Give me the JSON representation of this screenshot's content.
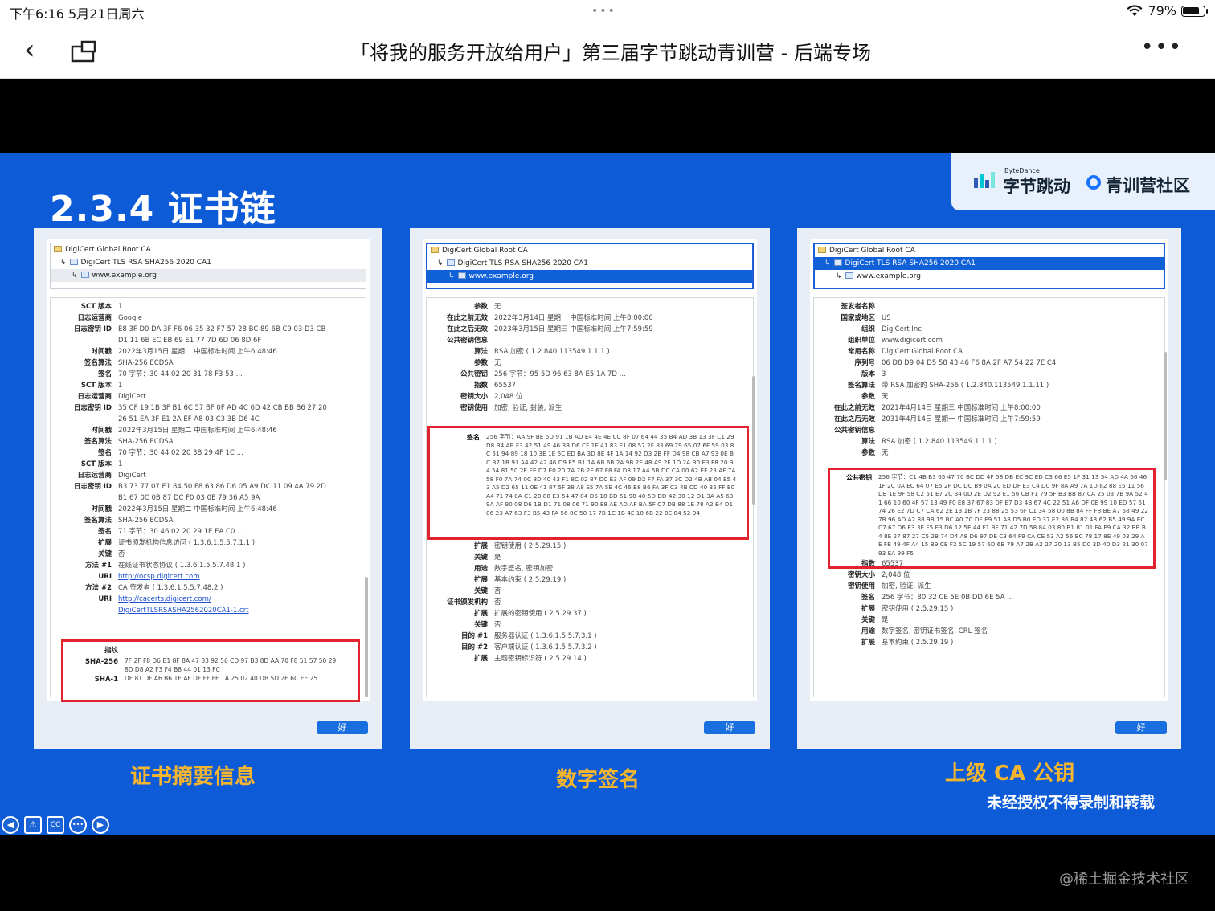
{
  "status_bar": {
    "time_date": "下午6:16   5月21日周六",
    "dots": "•••",
    "battery": "79%",
    "battery_level": 0.79
  },
  "nav": {
    "back_icon": "chevron-left-icon",
    "window_icon": "picture-in-picture-icon",
    "title": "「将我的服务开放给用户」第三届字节跳动青训营 - 后端专场",
    "more": "•••"
  },
  "slide": {
    "title": "2.3.4 证书链",
    "logo_small": "ByteDance",
    "logo_bytedance": "字节跳动",
    "logo_community": "青训营社区",
    "captions": [
      "证书摘要信息",
      "数字签名",
      "上级 CA 公钥"
    ],
    "notice": "未经授权不得录制和转载"
  },
  "panels": [
    {
      "tree": [
        "DigiCert Global Root CA",
        "DigiCert TLS RSA SHA256 2020 CA1",
        "www.example.org"
      ],
      "selected": 2,
      "ok": "好",
      "details": [
        {
          "k": "SCT 版本",
          "v": "1"
        },
        {
          "k": "日志运营商",
          "v": "Google"
        },
        {
          "k": "日志密钥 ID",
          "v": "E8 3F D0 DA 3F F6 06 35 32 F7 57 28 BC 89 6B C9 03 D3 CB"
        },
        {
          "k": "",
          "v": "D1 11 6B EC EB 69 E1 77 7D 6D 06 8D 6F"
        },
        {
          "k": "时间戳",
          "v": "2022年3月15日 星期二 中国标准时间 上午6:48:46"
        },
        {
          "k": "签名算法",
          "v": "SHA-256 ECDSA"
        },
        {
          "k": "签名",
          "v": "70 字节：30 44 02 20 31 78 F3 53 ..."
        },
        {
          "k": "SCT 版本",
          "v": "1"
        },
        {
          "k": "日志运营商",
          "v": "DigiCert"
        },
        {
          "k": "日志密钥 ID",
          "v": "35 CF 19 1B 3F B1 6C 57 BF 0F AD 4C 6D 42 CB BB B6 27 20"
        },
        {
          "k": "",
          "v": "26 51 EA 3F E1 2A EF A8 03 C3 3B D6 4C"
        },
        {
          "k": "时间戳",
          "v": "2022年3月15日 星期二 中国标准时间 上午6:48:46"
        },
        {
          "k": "签名算法",
          "v": "SHA-256 ECDSA"
        },
        {
          "k": "签名",
          "v": "70 字节：30 44 02 20 3B 29 4F 1C ..."
        },
        {
          "k": "SCT 版本",
          "v": "1"
        },
        {
          "k": "日志运营商",
          "v": "DigiCert"
        },
        {
          "k": "日志密钥 ID",
          "v": "B3 73 77 07 E1 84 50 F8 63 86 D6 05 A9 DC 11 09 4A 79 2D"
        },
        {
          "k": "",
          "v": "B1 67 0C 0B 87 DC F0 03 0E 79 36 A5 9A"
        },
        {
          "k": "时间戳",
          "v": "2022年3月15日 星期二 中国标准时间 上午6:48:46"
        },
        {
          "k": "签名算法",
          "v": "SHA-256 ECDSA"
        },
        {
          "k": "签名",
          "v": "71 字节：30 46 02 20 29 1E EA C0 ..."
        },
        {
          "k": "",
          "v": ""
        },
        {
          "k": "扩展",
          "v": "证书颁发机构信息访问 ( 1.3.6.1.5.5.7.1.1 )"
        },
        {
          "k": "关键",
          "v": "否"
        },
        {
          "k": "方法 #1",
          "v": "在线证书状态协议 ( 1.3.6.1.5.5.7.48.1 )"
        },
        {
          "k": "URI",
          "v": "http://ocsp.digicert.com",
          "link": true
        },
        {
          "k": "方法 #2",
          "v": "CA 签发者 ( 1.3.6.1.5.5.7.48.2 )"
        },
        {
          "k": "URI",
          "v": "http://cacerts.digicert.com/",
          "link": true
        },
        {
          "k": "",
          "v": "DigiCertTLSRSASHA2562020CA1-1.crt",
          "link": true
        }
      ],
      "fingerprint": {
        "label": "指纹",
        "sha256_label": "SHA-256",
        "sha256": "7F 2F F8 D6 B1 8F 8A 47 83 92 56 CD 97 B3 8D AA 70 F8 51 57 50 29 8D D8 A2 F3 F4 B8 44 01 13 FC",
        "sha1_label": "SHA-1",
        "sha1": "DF 81 DF A6 B6 1E AF DF FF FE 1A 25 02 40 DB 5D 2E 6C EE 25"
      }
    },
    {
      "tree": [
        "DigiCert Global Root CA",
        "DigiCert TLS RSA SHA256 2020 CA1",
        "www.example.org"
      ],
      "selected": 2,
      "ok": "好",
      "details": [
        {
          "k": "参数",
          "v": "无"
        },
        {
          "k": "",
          "v": ""
        },
        {
          "k": "在此之前无效",
          "v": "2022年3月14日 星期一 中国标准时间 上午8:00:00"
        },
        {
          "k": "在此之后无效",
          "v": "2023年3月15日 星期三 中国标准时间 上午7:59:59"
        },
        {
          "k": "",
          "v": ""
        },
        {
          "k": "公共密钥信息",
          "v": ""
        },
        {
          "k": "算法",
          "v": "RSA 加密 ( 1.2.840.113549.1.1.1 )"
        },
        {
          "k": "参数",
          "v": "无"
        },
        {
          "k": "公共密钥",
          "v": "256 字节：95 5D 96 63 8A E5 1A 7D ..."
        },
        {
          "k": "指数",
          "v": "65537"
        },
        {
          "k": "密钥大小",
          "v": "2,048 位"
        },
        {
          "k": "密钥使用",
          "v": "加密, 验证, 封装, 派生"
        }
      ],
      "signature": {
        "label": "签名",
        "value": "256 字节：AA 9F BE 5D 91 1B AD E4 4E 4E CC 8F 07 64 44 35 B4 AD 3B 13 3F C1 29 D8 B4 AB F3 42 51 49 46 3B D6 CF 1E 41 83 E1 08 57 2F 83 69 79 65 07 6F 59 03 8C 51 94 89 18 10 3E 1E 5C ED BA 3D 8E 4F 1A 14 92 D3 2B FF D4 98 CB A7 93 0E BC B7 1B 93 A4 42 42 46 D9 E5 B1 1A 6B 6B 2A 9B 2E 48 A9 2F 1D 2A B0 E3 F8 20 94 54 81 50 2E EE D7 E0 20 7A 7B 2E 67 F8 FA D8 17 A4 5B DC CA 00 62 EF 23 AF 7A 58 F0 7A 74 0C 8D 40 43 F1 8C 02 87 DC E3 AF 09 D2 F7 FA 37 3C D2 4B AB 04 E5 43 A5 D2 65 11 0E 41 87 5F 38 A8 E5 7A 5E 4C 46 B8 B6 FA 3F C3 4B CD 40 35 FF E0 A4 71 74 0A C1 20 88 E3 54 47 84 D5 18 BD 51 98 40 5D DD 42 30 12 D1 3A A5 63 9A AF 90 08 D6 1B D1 71 08 06 71 90 E8 AE AD AF BA 5F C7 DB 88 1E 78 A2 B4 D1 06 23 A7 63 F3 B5 43 FA 56 8C 50 17 7B 1C 1B 4E 10 6B 22 0E 84 52 94"
      },
      "details2": [
        {
          "k": "扩展",
          "v": "密钥使用 ( 2.5.29.15 )"
        },
        {
          "k": "关键",
          "v": "是"
        },
        {
          "k": "用途",
          "v": "数字签名, 密钥加密"
        },
        {
          "k": "",
          "v": ""
        },
        {
          "k": "扩展",
          "v": "基本约束 ( 2.5.29.19 )"
        },
        {
          "k": "关键",
          "v": "否"
        },
        {
          "k": "证书颁发机构",
          "v": "否"
        },
        {
          "k": "",
          "v": ""
        },
        {
          "k": "扩展",
          "v": "扩展的密钥使用 ( 2.5.29.37 )"
        },
        {
          "k": "关键",
          "v": "否"
        },
        {
          "k": "目的 #1",
          "v": "服务器认证 ( 1.3.6.1.5.5.7.3.1 )"
        },
        {
          "k": "目的 #2",
          "v": "客户端认证 ( 1.3.6.1.5.5.7.3.2 )"
        },
        {
          "k": "",
          "v": ""
        },
        {
          "k": "扩展",
          "v": "主题密钥标识符 ( 2.5.29.14 )"
        }
      ]
    },
    {
      "tree": [
        "DigiCert Global Root CA",
        "DigiCert TLS RSA SHA256 2020 CA1",
        "www.example.org"
      ],
      "selected": 1,
      "ok": "好",
      "details": [
        {
          "k": "签发者名称",
          "v": ""
        },
        {
          "k": "国家或地区",
          "v": "US"
        },
        {
          "k": "组织",
          "v": "DigiCert Inc"
        },
        {
          "k": "组织单位",
          "v": "www.digicert.com"
        },
        {
          "k": "常用名称",
          "v": "DigiCert Global Root CA"
        },
        {
          "k": "",
          "v": ""
        },
        {
          "k": "序列号",
          "v": "06 D8 D9 04 D5 58 43 46 F6 8A 2F A7 54 22 7E C4"
        },
        {
          "k": "版本",
          "v": "3"
        },
        {
          "k": "签名算法",
          "v": "带 RSA 加密的 SHA-256 ( 1.2.840.113549.1.1.11 )"
        },
        {
          "k": "参数",
          "v": "无"
        },
        {
          "k": "",
          "v": ""
        },
        {
          "k": "在此之前无效",
          "v": "2021年4月14日 星期三 中国标准时间 上午8:00:00"
        },
        {
          "k": "在此之后无效",
          "v": "2031年4月14日 星期一 中国标准时间 上午7:59:59"
        },
        {
          "k": "",
          "v": ""
        },
        {
          "k": "公共密钥信息",
          "v": ""
        },
        {
          "k": "算法",
          "v": "RSA 加密 ( 1.2.840.113549.1.1.1 )"
        },
        {
          "k": "参数",
          "v": "无"
        }
      ],
      "public_key": {
        "label": "公共密钥",
        "value": "256 字节：C1 4B B3 65 47 70 BC DD 4F 58 DB EC 9C ED C3 66 E5 1F 31 13 54 AD 4A 66 46 1F 2C 0A EC 64 07 E5 2F DC DC B9 0A 20 ED DF E3 C4 D0 9F 8A A9 7A 1D 82 88 E5 11 56 DB 1E 9F 58 C2 51 E7 2C 34 0D 2E D2 92 E1 56 CB F1 79 5F B3 BB 87 CA 25 03 7B 9A 52 41 66 10 60 4F 57 13 49 F0 E8 37 67 83 DF E7 D3 4B 67 4C 22 51 A6 DF 0E 99 10 ED 57 51 74 26 E2 7D C7 CA 62 2E 13 1B 7F 23 88 25 53 6F C1 34 58 00 8B 84 FF F8 BE A7 58 49 22 7B 96 AD A2 88 9B 15 BC A0 7C DF E9 51 A8 D5 B0 ED 37 E2 36 B4 82 4B 62 B5 49 9A EC C7 67 D6 E3 3E F5 E3 D6 12 5E 44 F1 BF 71 42 7D 58 84 03 80 B1 81 01 FA F9 CA 32 BB B4 8E 27 87 27 C5 2B 74 D4 A8 D6 97 DE C3 64 F9 CA CE 53 A2 56 BC 78 17 8E 49 03 29 AE FB 49 4F A4 15 B9 CE F2 5C 19 57 6D 6B 79 A7 2B A2 27 20 13 B5 D0 3D 40 D3 21 30 07 93 EA 99 F5"
      },
      "details2": [
        {
          "k": "指数",
          "v": "65537"
        },
        {
          "k": "密钥大小",
          "v": "2,048 位"
        },
        {
          "k": "密钥使用",
          "v": "加密, 验证, 派生"
        },
        {
          "k": "",
          "v": ""
        },
        {
          "k": "签名",
          "v": "256 字节：80 32 CE 5E 0B DD 6E 5A ..."
        },
        {
          "k": "",
          "v": ""
        },
        {
          "k": "",
          "v": ""
        },
        {
          "k": "扩展",
          "v": "密钥使用 ( 2.5.29.15 )"
        },
        {
          "k": "关键",
          "v": "是"
        },
        {
          "k": "用途",
          "v": "数字签名, 密钥证书签名, CRL 签名"
        },
        {
          "k": "",
          "v": ""
        },
        {
          "k": "扩展",
          "v": "基本约束 ( 2.5.29.19 )"
        }
      ]
    }
  ],
  "controls": [
    "◀",
    "⚠",
    "CC",
    "•••",
    "▶"
  ],
  "watermark": "@稀土掘金技术社区"
}
